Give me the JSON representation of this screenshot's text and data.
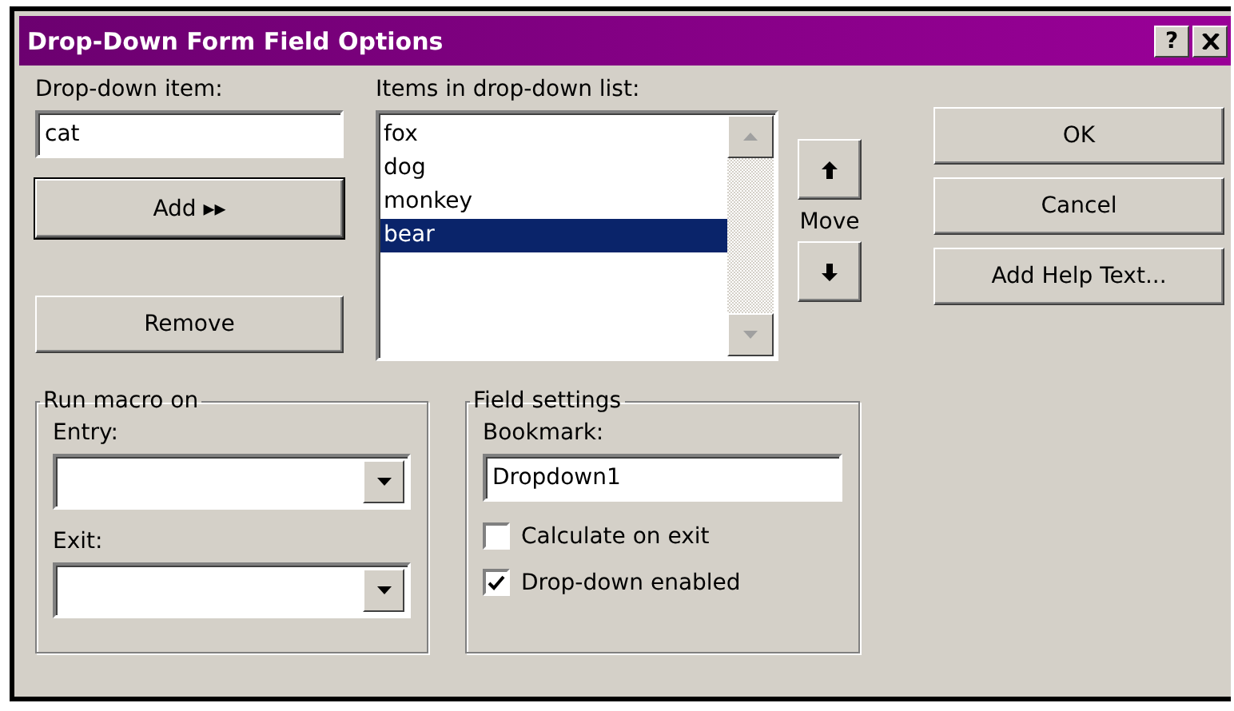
{
  "window": {
    "title": "Drop-Down Form Field Options",
    "help_button": "?"
  },
  "drop_down_item": {
    "label": "Drop-down item:",
    "value": "cat"
  },
  "add_button": "Add ▸▸",
  "remove_button": "Remove",
  "items_list": {
    "label": "Items in drop-down list:",
    "items": [
      {
        "label": "fox",
        "selected": false
      },
      {
        "label": "dog",
        "selected": false
      },
      {
        "label": "monkey",
        "selected": false
      },
      {
        "label": "bear",
        "selected": true
      }
    ]
  },
  "move_label": "Move",
  "buttons": [
    "OK",
    "Cancel",
    "Add Help Text..."
  ],
  "run_macro": {
    "title": "Run macro on",
    "entry_label": "Entry:",
    "exit_label": "Exit:"
  },
  "field_settings": {
    "title": "Field settings",
    "bookmark_label": "Bookmark:",
    "bookmark_value": "Dropdown1",
    "options": [
      {
        "label": "Calculate on exit",
        "checked": false
      },
      {
        "label": "Drop-down enabled",
        "checked": true
      }
    ]
  }
}
